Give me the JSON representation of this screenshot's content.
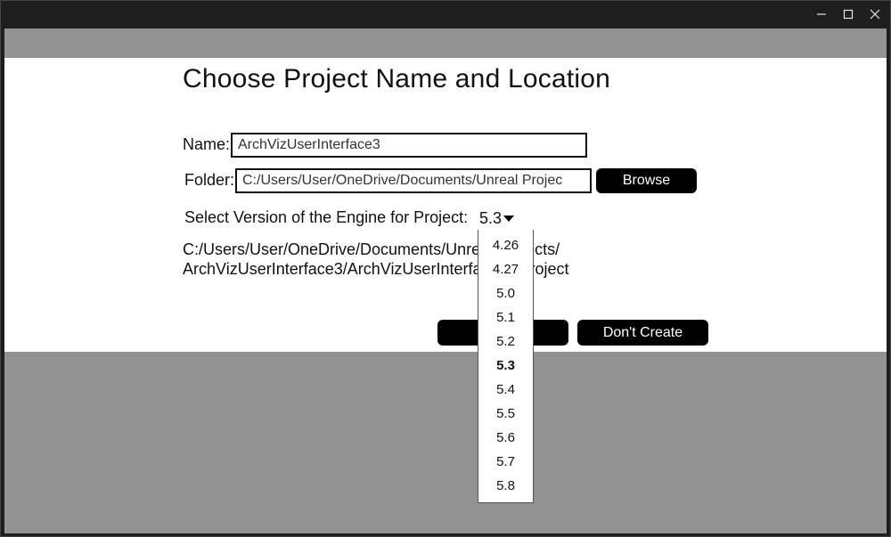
{
  "titlebar": {
    "icons": [
      "minimize-icon",
      "maximize-icon",
      "close-icon"
    ]
  },
  "page": {
    "title": "Choose Project Name and Location"
  },
  "form": {
    "name_label": "Name:",
    "name_value": "ArchVizUserInterface3",
    "folder_label": "Folder:",
    "folder_value": "C:/Users/User/OneDrive/Documents/Unreal Projec",
    "browse_label": "Browse",
    "version_label": "Select Version of the Engine for Project:",
    "version_selected": "5.3",
    "path_line1": "C:/Users/User/OneDrive/Documents/Unreal Projects/",
    "path_line2": "ArchVizUserInterface3/ArchVizUserInterface3.uproject",
    "create_label": "",
    "dont_create_label": "Don't Create"
  },
  "dropdown": {
    "options": [
      "4.26",
      "4.27",
      "5.0",
      "5.1",
      "5.2",
      "5.3",
      "5.4",
      "5.5",
      "5.6",
      "5.7",
      "5.8"
    ],
    "selected": "5.3"
  },
  "colors": {
    "panel_bg": "#ffffff",
    "backdrop_gray": "#929292",
    "titlebar_bg": "#1e1e1e",
    "button_bg": "#000000",
    "button_text": "#ffffff"
  }
}
